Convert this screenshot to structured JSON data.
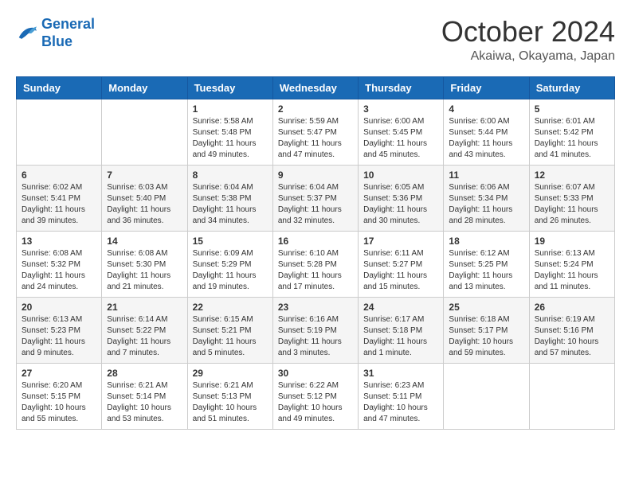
{
  "header": {
    "logo_line1": "General",
    "logo_line2": "Blue",
    "month": "October 2024",
    "location": "Akaiwa, Okayama, Japan"
  },
  "weekdays": [
    "Sunday",
    "Monday",
    "Tuesday",
    "Wednesday",
    "Thursday",
    "Friday",
    "Saturday"
  ],
  "weeks": [
    [
      {
        "day": "",
        "info": ""
      },
      {
        "day": "",
        "info": ""
      },
      {
        "day": "1",
        "info": "Sunrise: 5:58 AM\nSunset: 5:48 PM\nDaylight: 11 hours and 49 minutes."
      },
      {
        "day": "2",
        "info": "Sunrise: 5:59 AM\nSunset: 5:47 PM\nDaylight: 11 hours and 47 minutes."
      },
      {
        "day": "3",
        "info": "Sunrise: 6:00 AM\nSunset: 5:45 PM\nDaylight: 11 hours and 45 minutes."
      },
      {
        "day": "4",
        "info": "Sunrise: 6:00 AM\nSunset: 5:44 PM\nDaylight: 11 hours and 43 minutes."
      },
      {
        "day": "5",
        "info": "Sunrise: 6:01 AM\nSunset: 5:42 PM\nDaylight: 11 hours and 41 minutes."
      }
    ],
    [
      {
        "day": "6",
        "info": "Sunrise: 6:02 AM\nSunset: 5:41 PM\nDaylight: 11 hours and 39 minutes."
      },
      {
        "day": "7",
        "info": "Sunrise: 6:03 AM\nSunset: 5:40 PM\nDaylight: 11 hours and 36 minutes."
      },
      {
        "day": "8",
        "info": "Sunrise: 6:04 AM\nSunset: 5:38 PM\nDaylight: 11 hours and 34 minutes."
      },
      {
        "day": "9",
        "info": "Sunrise: 6:04 AM\nSunset: 5:37 PM\nDaylight: 11 hours and 32 minutes."
      },
      {
        "day": "10",
        "info": "Sunrise: 6:05 AM\nSunset: 5:36 PM\nDaylight: 11 hours and 30 minutes."
      },
      {
        "day": "11",
        "info": "Sunrise: 6:06 AM\nSunset: 5:34 PM\nDaylight: 11 hours and 28 minutes."
      },
      {
        "day": "12",
        "info": "Sunrise: 6:07 AM\nSunset: 5:33 PM\nDaylight: 11 hours and 26 minutes."
      }
    ],
    [
      {
        "day": "13",
        "info": "Sunrise: 6:08 AM\nSunset: 5:32 PM\nDaylight: 11 hours and 24 minutes."
      },
      {
        "day": "14",
        "info": "Sunrise: 6:08 AM\nSunset: 5:30 PM\nDaylight: 11 hours and 21 minutes."
      },
      {
        "day": "15",
        "info": "Sunrise: 6:09 AM\nSunset: 5:29 PM\nDaylight: 11 hours and 19 minutes."
      },
      {
        "day": "16",
        "info": "Sunrise: 6:10 AM\nSunset: 5:28 PM\nDaylight: 11 hours and 17 minutes."
      },
      {
        "day": "17",
        "info": "Sunrise: 6:11 AM\nSunset: 5:27 PM\nDaylight: 11 hours and 15 minutes."
      },
      {
        "day": "18",
        "info": "Sunrise: 6:12 AM\nSunset: 5:25 PM\nDaylight: 11 hours and 13 minutes."
      },
      {
        "day": "19",
        "info": "Sunrise: 6:13 AM\nSunset: 5:24 PM\nDaylight: 11 hours and 11 minutes."
      }
    ],
    [
      {
        "day": "20",
        "info": "Sunrise: 6:13 AM\nSunset: 5:23 PM\nDaylight: 11 hours and 9 minutes."
      },
      {
        "day": "21",
        "info": "Sunrise: 6:14 AM\nSunset: 5:22 PM\nDaylight: 11 hours and 7 minutes."
      },
      {
        "day": "22",
        "info": "Sunrise: 6:15 AM\nSunset: 5:21 PM\nDaylight: 11 hours and 5 minutes."
      },
      {
        "day": "23",
        "info": "Sunrise: 6:16 AM\nSunset: 5:19 PM\nDaylight: 11 hours and 3 minutes."
      },
      {
        "day": "24",
        "info": "Sunrise: 6:17 AM\nSunset: 5:18 PM\nDaylight: 11 hours and 1 minute."
      },
      {
        "day": "25",
        "info": "Sunrise: 6:18 AM\nSunset: 5:17 PM\nDaylight: 10 hours and 59 minutes."
      },
      {
        "day": "26",
        "info": "Sunrise: 6:19 AM\nSunset: 5:16 PM\nDaylight: 10 hours and 57 minutes."
      }
    ],
    [
      {
        "day": "27",
        "info": "Sunrise: 6:20 AM\nSunset: 5:15 PM\nDaylight: 10 hours and 55 minutes."
      },
      {
        "day": "28",
        "info": "Sunrise: 6:21 AM\nSunset: 5:14 PM\nDaylight: 10 hours and 53 minutes."
      },
      {
        "day": "29",
        "info": "Sunrise: 6:21 AM\nSunset: 5:13 PM\nDaylight: 10 hours and 51 minutes."
      },
      {
        "day": "30",
        "info": "Sunrise: 6:22 AM\nSunset: 5:12 PM\nDaylight: 10 hours and 49 minutes."
      },
      {
        "day": "31",
        "info": "Sunrise: 6:23 AM\nSunset: 5:11 PM\nDaylight: 10 hours and 47 minutes."
      },
      {
        "day": "",
        "info": ""
      },
      {
        "day": "",
        "info": ""
      }
    ]
  ]
}
